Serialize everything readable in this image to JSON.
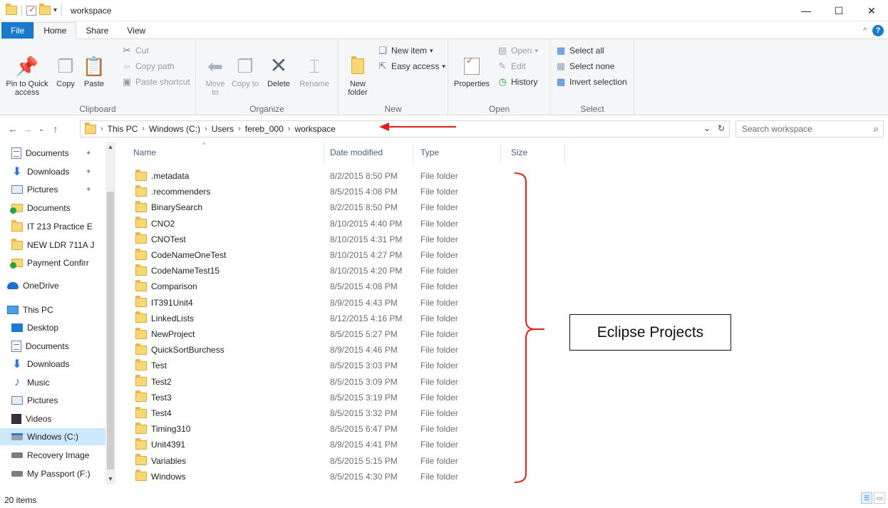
{
  "window": {
    "title": "workspace"
  },
  "tabs": [
    {
      "label": "File"
    },
    {
      "label": "Home"
    },
    {
      "label": "Share"
    },
    {
      "label": "View"
    }
  ],
  "ribbon": {
    "clipboard": {
      "label": "Clipboard",
      "pin_to_quick_access": "Pin to Quick access",
      "copy": "Copy",
      "paste": "Paste",
      "cut": "Cut",
      "copy_path": "Copy path",
      "paste_shortcut": "Paste shortcut"
    },
    "organize": {
      "label": "Organize",
      "move_to": "Move to",
      "copy_to": "Copy to",
      "delete": "Delete",
      "rename": "Rename"
    },
    "new": {
      "label": "New",
      "new_folder": "New folder",
      "new_item": "New item",
      "easy_access": "Easy access"
    },
    "open": {
      "label": "Open",
      "properties": "Properties",
      "open": "Open",
      "edit": "Edit",
      "history": "History"
    },
    "select": {
      "label": "Select",
      "select_all": "Select all",
      "select_none": "Select none",
      "invert_selection": "Invert selection"
    }
  },
  "address": {
    "crumbs": [
      "This PC",
      "Windows (C:)",
      "Users",
      "fereb_000",
      "workspace"
    ],
    "search_placeholder": "Search workspace"
  },
  "nav": [
    {
      "label": "Documents",
      "icon": "document-icon",
      "pinned": true
    },
    {
      "label": "Downloads",
      "icon": "download-icon",
      "pinned": true
    },
    {
      "label": "Pictures",
      "icon": "pictures-icon",
      "pinned": true
    },
    {
      "label": "Documents",
      "icon": "synced-folder-icon"
    },
    {
      "label": "IT 213 Practice E",
      "icon": "folder-icon"
    },
    {
      "label": "NEW LDR 711A J",
      "icon": "folder-icon"
    },
    {
      "label": "Payment Confirr",
      "icon": "synced-folder-icon"
    },
    {
      "label": "OneDrive",
      "icon": "onedrive-icon"
    },
    {
      "label": "This PC",
      "icon": "this-pc-icon"
    },
    {
      "label": "Desktop",
      "icon": "desktop-icon"
    },
    {
      "label": "Documents",
      "icon": "document-icon"
    },
    {
      "label": "Downloads",
      "icon": "download-icon"
    },
    {
      "label": "Music",
      "icon": "music-icon"
    },
    {
      "label": "Pictures",
      "icon": "pictures-icon"
    },
    {
      "label": "Videos",
      "icon": "videos-icon"
    },
    {
      "label": "Windows (C:)",
      "icon": "windows-drive-icon"
    },
    {
      "label": "Recovery Image",
      "icon": "drive-icon"
    },
    {
      "label": "My Passport (F:)",
      "icon": "drive-icon"
    }
  ],
  "columns": {
    "name": "Name",
    "date": "Date modified",
    "type": "Type",
    "size": "Size"
  },
  "files": [
    {
      "name": ".metadata",
      "date": "8/2/2015 8:50 PM",
      "type": "File folder"
    },
    {
      "name": ".recommenders",
      "date": "8/5/2015 4:08 PM",
      "type": "File folder"
    },
    {
      "name": "BinarySearch",
      "date": "8/2/2015 8:50 PM",
      "type": "File folder"
    },
    {
      "name": "CNO2",
      "date": "8/10/2015 4:40 PM",
      "type": "File folder"
    },
    {
      "name": "CNOTest",
      "date": "8/10/2015 4:31 PM",
      "type": "File folder"
    },
    {
      "name": "CodeNameOneTest",
      "date": "8/10/2015 4:27 PM",
      "type": "File folder"
    },
    {
      "name": "CodeNameTest15",
      "date": "8/10/2015 4:20 PM",
      "type": "File folder"
    },
    {
      "name": "Comparison",
      "date": "8/5/2015 4:08 PM",
      "type": "File folder"
    },
    {
      "name": "IT391Unit4",
      "date": "8/9/2015 4:43 PM",
      "type": "File folder"
    },
    {
      "name": "LinkedLists",
      "date": "8/12/2015 4:16 PM",
      "type": "File folder"
    },
    {
      "name": "NewProject",
      "date": "8/5/2015 5:27 PM",
      "type": "File folder"
    },
    {
      "name": "QuickSortBurchess",
      "date": "8/9/2015 4:46 PM",
      "type": "File folder"
    },
    {
      "name": "Test",
      "date": "8/5/2015 3:03 PM",
      "type": "File folder"
    },
    {
      "name": "Test2",
      "date": "8/5/2015 3:09 PM",
      "type": "File folder"
    },
    {
      "name": "Test3",
      "date": "8/5/2015 3:19 PM",
      "type": "File folder"
    },
    {
      "name": "Test4",
      "date": "8/5/2015 3:32 PM",
      "type": "File folder"
    },
    {
      "name": "Timing310",
      "date": "8/5/2015 6:47 PM",
      "type": "File folder"
    },
    {
      "name": "Unit4391",
      "date": "8/9/2015 4:41 PM",
      "type": "File folder"
    },
    {
      "name": "Variables",
      "date": "8/5/2015 5:15 PM",
      "type": "File folder"
    },
    {
      "name": "Windows",
      "date": "8/5/2015 4:30 PM",
      "type": "File folder"
    }
  ],
  "annotation": {
    "callout": "Eclipse Projects",
    "color": "#e02020"
  },
  "status": {
    "items": "20 items"
  },
  "colors": {
    "file_tab": "#1979ca",
    "selected": "#cce8ff",
    "folder": "#f8d775"
  }
}
